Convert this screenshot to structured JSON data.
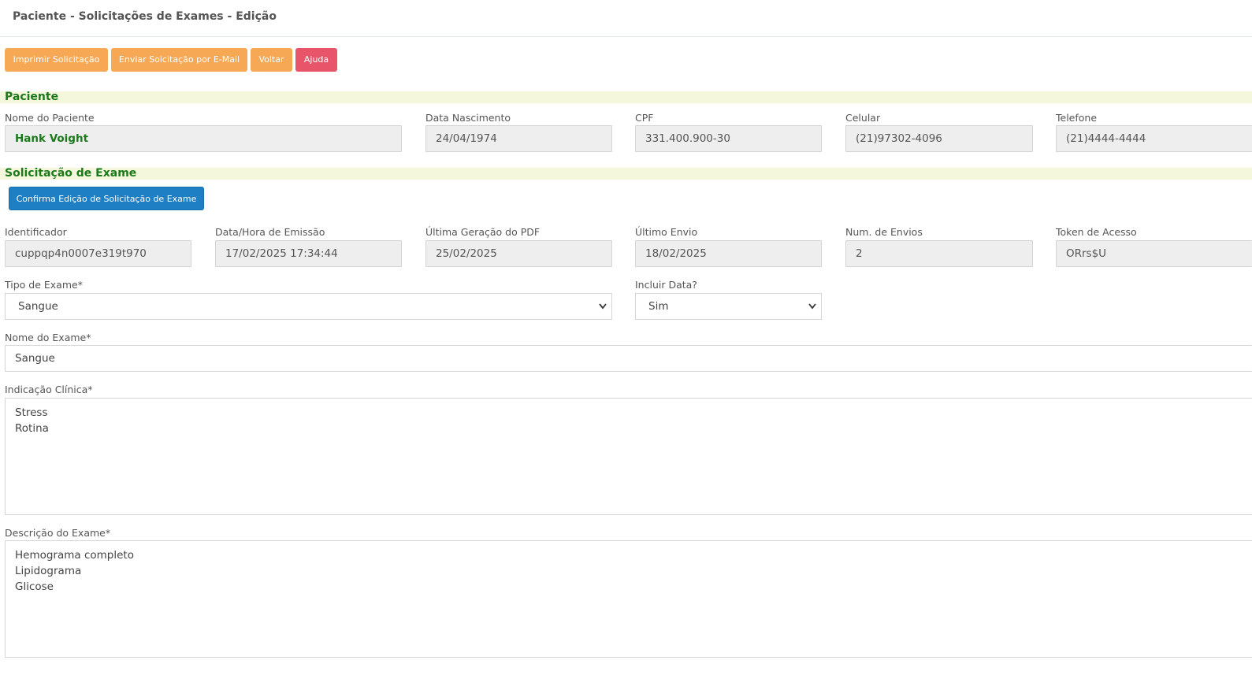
{
  "header": {
    "title": "Paciente - Solicitações de Exames - Edição"
  },
  "toolbar": {
    "print_label": "Imprimir Solicitação",
    "email_label": "Enviar Solcitação por E-Mail",
    "back_label": "Voltar",
    "help_label": "Ajuda",
    "colors": {
      "warning": "#f7a854",
      "danger": "#e8556a",
      "primary": "#1e7fc4"
    }
  },
  "patient": {
    "section_title": "Paciente",
    "name_label": "Nome do Paciente",
    "name_value": "Hank Voight",
    "birth_label": "Data Nascimento",
    "birth_value": "24/04/1974",
    "cpf_label": "CPF",
    "cpf_value": "331.400.900-30",
    "mobile_label": "Celular",
    "mobile_value": "(21)97302-4096",
    "phone_label": "Telefone",
    "phone_value": "(21)4444-4444"
  },
  "request": {
    "section_title": "Solicitação de Exame",
    "confirm_label": "Confirma Edição de Solicitação de Exame",
    "id_label": "Identificador",
    "id_value": "cuppqp4n0007e319t970",
    "issued_label": "Data/Hora de Emissão",
    "issued_value": "17/02/2025 17:34:44",
    "pdf_label": "Última Geração do PDF",
    "pdf_value": "25/02/2025",
    "last_send_label": "Último Envio",
    "last_send_value": "18/02/2025",
    "sends_label": "Num. de Envios",
    "sends_value": "2",
    "token_label": "Token de Acesso",
    "token_value": "ORrs$U",
    "exam_type_label": "Tipo de Exame*",
    "exam_type_value": "Sangue",
    "include_date_label": "Incluir Data?",
    "include_date_value": "Sim",
    "exam_name_label": "Nome do Exame*",
    "exam_name_value": "Sangue",
    "clinical_label": "Indicação Clínica*",
    "clinical_lines": [
      "Stress",
      "Rotina"
    ],
    "description_label": "Descrição do Exame*",
    "description_lines": [
      "Hemograma completo",
      "Lipidograma",
      "Glicose"
    ]
  }
}
